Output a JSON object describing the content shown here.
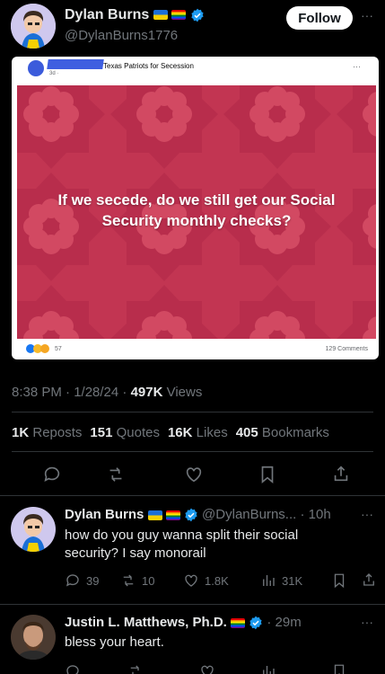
{
  "tweet": {
    "author_name": "Dylan Burns",
    "author_handle": "@DylanBurns1776",
    "follow_label": "Follow",
    "more_label": "···",
    "timestamp": "8:38 PM · 1/28/24 ·",
    "views_count": "497K",
    "views_label": "Views",
    "stats": [
      {
        "count": "1K",
        "label": "Reposts"
      },
      {
        "count": "151",
        "label": "Quotes"
      },
      {
        "count": "16K",
        "label": "Likes"
      },
      {
        "count": "405",
        "label": "Bookmarks"
      }
    ]
  },
  "embedded_post": {
    "group_name": "Texas Patriots for Secession",
    "post_age": "3d ·",
    "more_label": "···",
    "image_text": "If we secede, do we still get our Social Security monthly checks?",
    "reaction_count": "57",
    "comments": "129 Comments",
    "colors": {
      "background": "#c23552",
      "pattern": "#b02a47",
      "flower": "#d2445f"
    }
  },
  "replies": [
    {
      "author_name": "Dylan Burns",
      "author_handle": "@DylanBurns...",
      "time": "· 10h",
      "text": "how do you guy wanna split their social security? I say monorail",
      "actions": {
        "replies": "39",
        "reposts": "10",
        "likes": "1.8K",
        "views": "31K"
      }
    },
    {
      "author_name": "Justin L. Matthews, Ph.D.",
      "time": "· 29m",
      "text": "bless your heart."
    }
  ],
  "colors": {
    "accent": "#1d9bf0",
    "muted": "#71767b",
    "divider": "#2f3336"
  }
}
